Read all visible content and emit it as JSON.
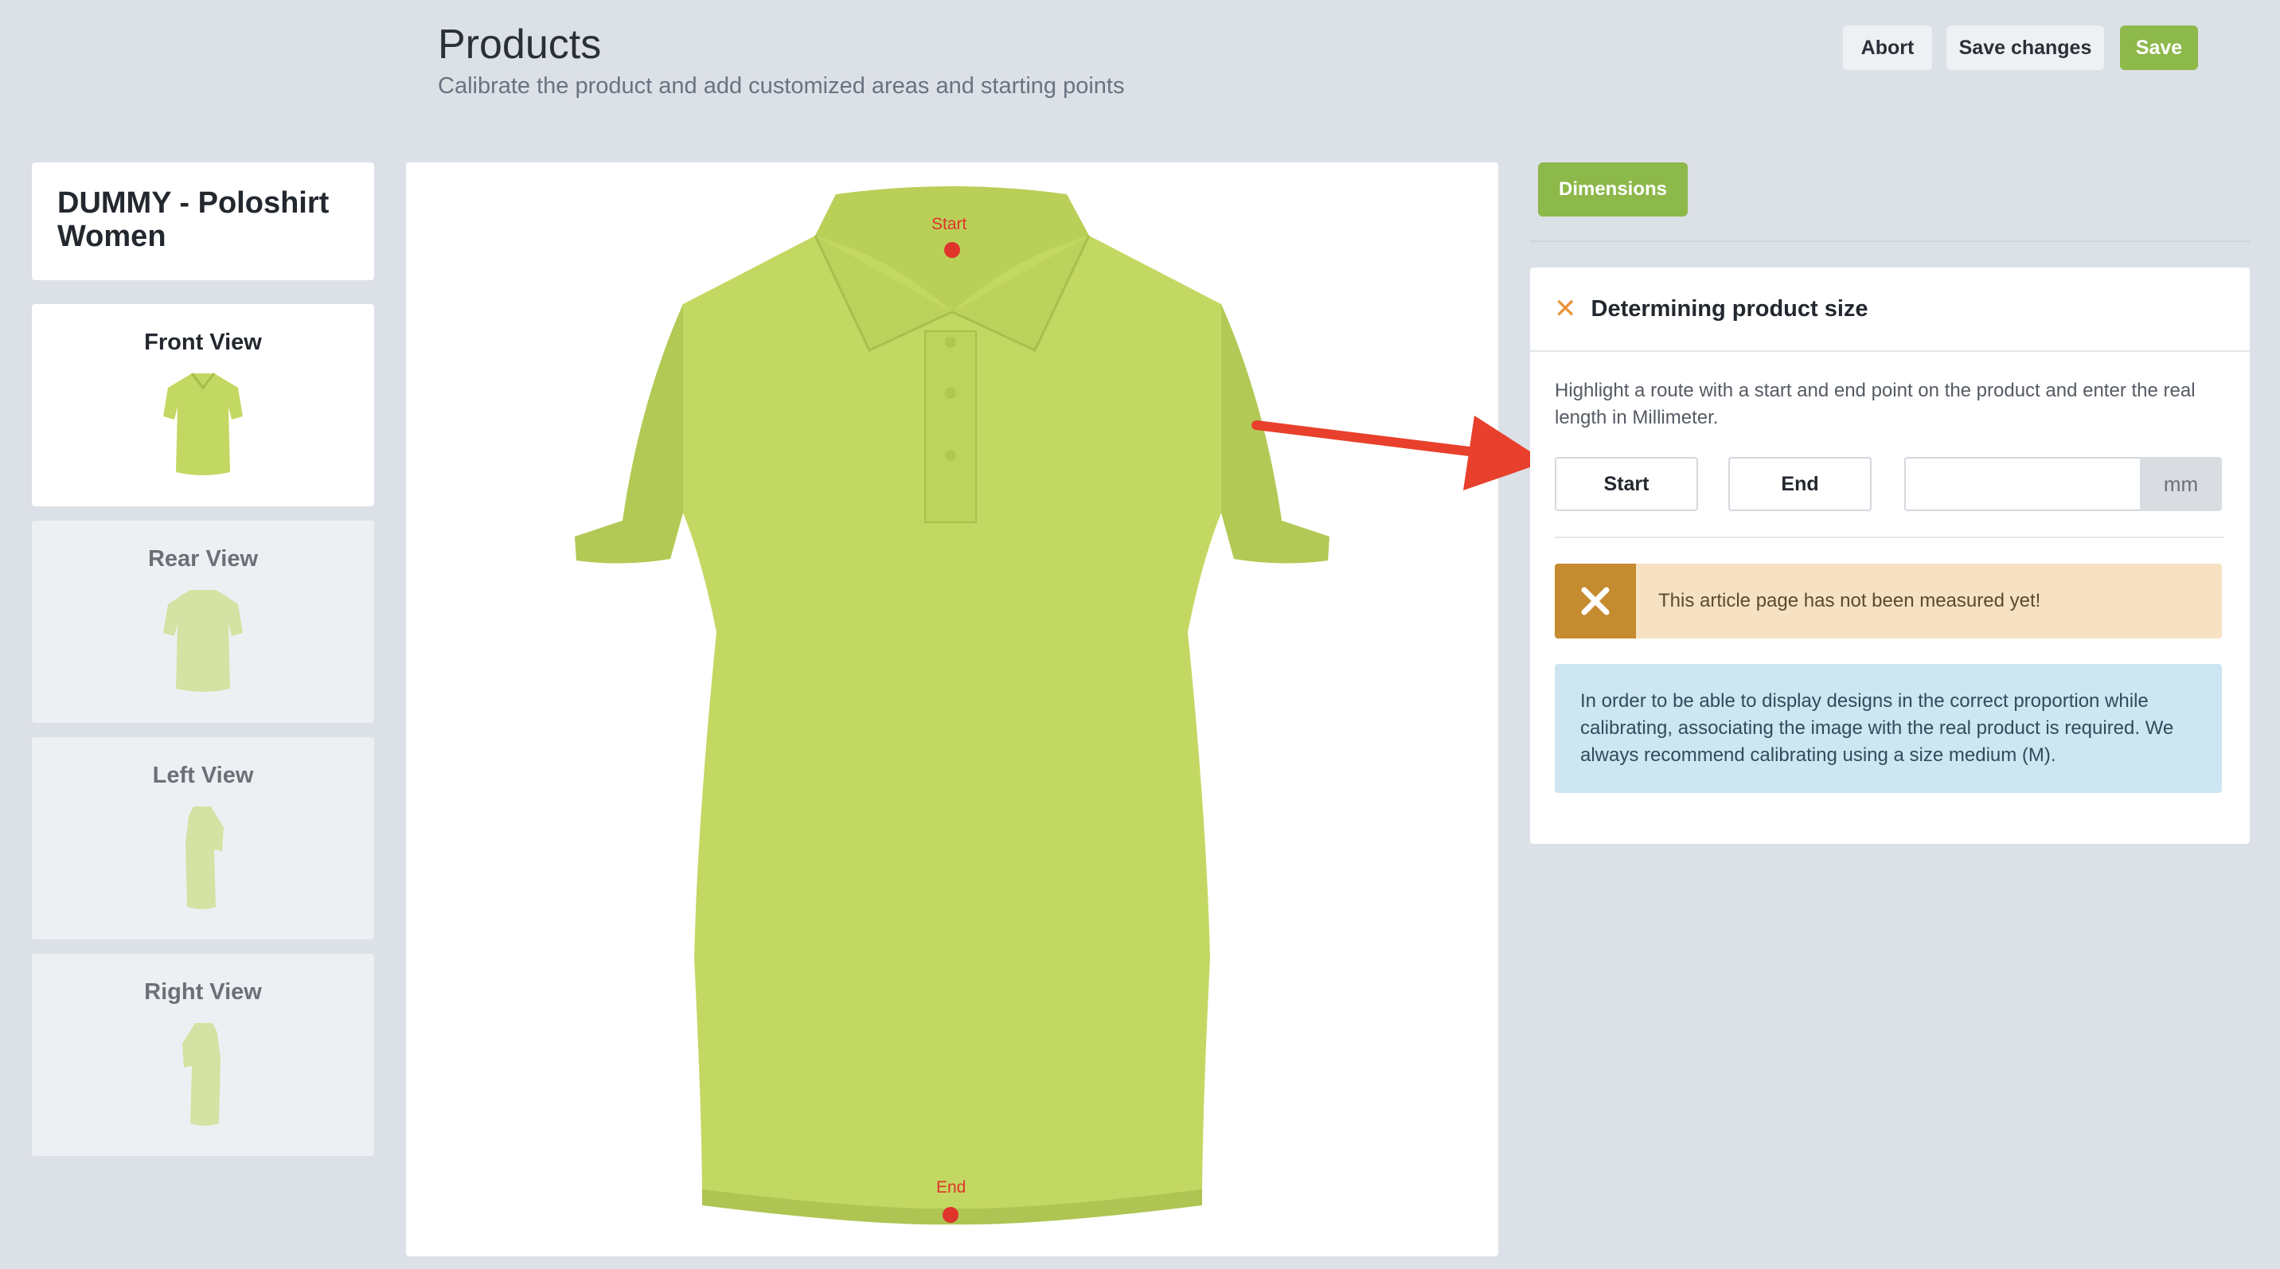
{
  "header": {
    "title": "Products",
    "subtitle": "Calibrate the product and add customized areas and starting points",
    "buttons": {
      "abort": "Abort",
      "save_changes": "Save changes",
      "save": "Save"
    }
  },
  "sidebar": {
    "product_name": "DUMMY - Poloshirt Women",
    "views": [
      {
        "label": "Front View",
        "active": true
      },
      {
        "label": "Rear View",
        "active": false
      },
      {
        "label": "Left View",
        "active": false
      },
      {
        "label": "Right View",
        "active": false
      }
    ]
  },
  "canvas": {
    "start_label": "Start",
    "end_label": "End",
    "shirt_color": "#c3d862"
  },
  "panel": {
    "tab_label": "Dimensions",
    "section_title": "Determining product size",
    "description": "Highlight a route with a start and end point on the product and enter the real length in Millimeter.",
    "start_button": "Start",
    "end_button": "End",
    "length_value": "",
    "unit": "mm",
    "warning": "This article page has not been measured yet!",
    "info": "In order to be able to display designs in the correct proportion while calibrating, associating the image with the real product is required. We always recommend calibrating using a size medium (M)."
  },
  "colors": {
    "accent": "#8db84a",
    "pin": "#e0332a",
    "arrow": "#e8402c",
    "warning_bg": "#f6e1c2",
    "warning_icon_bg": "#c58b2f",
    "info_bg": "#cde6f1"
  }
}
